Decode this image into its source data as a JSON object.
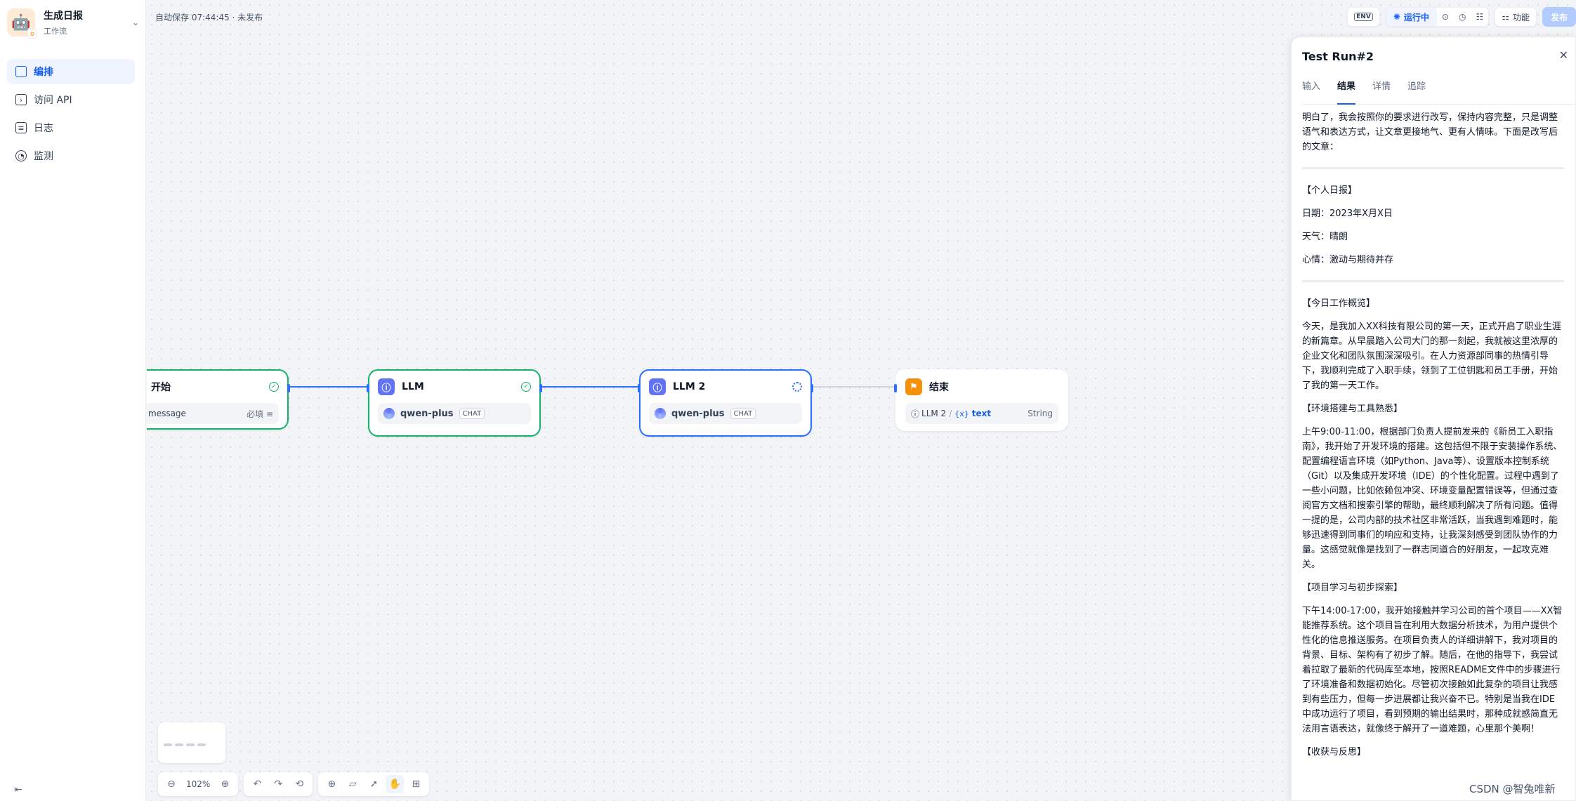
{
  "sidebar": {
    "app_name": "生成日报",
    "app_type": "工作流",
    "nav": [
      {
        "label": "编排",
        "icon": "layout-icon"
      },
      {
        "label": "访问 API",
        "icon": "terminal-icon"
      },
      {
        "label": "日志",
        "icon": "file-icon"
      },
      {
        "label": "监测",
        "icon": "monitor-icon"
      }
    ]
  },
  "header": {
    "autosave": "自动保存 07:44:45 · 未发布",
    "env_label": "ENV",
    "running_label": "运行中",
    "features_label": "功能",
    "publish_label": "发布"
  },
  "nodes": {
    "start": {
      "title": "开始",
      "var_name": "message",
      "var_required": "必填"
    },
    "llm1": {
      "title": "LLM",
      "model": "qwen-plus",
      "mode": "CHAT"
    },
    "llm2": {
      "title": "LLM 2",
      "model": "qwen-plus",
      "mode": "CHAT"
    },
    "end": {
      "title": "结束",
      "var_source": "LLM 2",
      "var_prefix": "{x}",
      "var_name": "text",
      "var_type": "String"
    }
  },
  "canvas": {
    "zoom": "102%"
  },
  "panel": {
    "title": "Test Run#2",
    "tabs": [
      "输入",
      "结果",
      "详情",
      "追踪"
    ],
    "intro": "明白了，我会按照你的要求进行改写，保持内容完整，只是调整语气和表达方式，让文章更接地气、更有人情味。下面是改写后的文章：",
    "report_title": "【个人日报】",
    "date": "日期：2023年X月X日",
    "weather": "天气：晴朗",
    "mood": "心情：激动与期待并存",
    "section1_title": "【今日工作概览】",
    "section1_text": "今天，是我加入XX科技有限公司的第一天，正式开启了职业生涯的新篇章。从早晨踏入公司大门的那一刻起，我就被这里浓厚的企业文化和团队氛围深深吸引。在人力资源部同事的热情引导下，我顺利完成了入职手续，领到了工位钥匙和员工手册，开始了我的第一天工作。",
    "section2_title": "【环境搭建与工具熟悉】",
    "section2_text": "上午9:00-11:00，根据部门负责人提前发来的《新员工入职指南》，我开始了开发环境的搭建。这包括但不限于安装操作系统、配置编程语言环境（如Python、Java等）、设置版本控制系统（Git）以及集成开发环境（IDE）的个性化配置。过程中遇到了一些小问题，比如依赖包冲突、环境变量配置错误等，但通过查阅官方文档和搜索引擎的帮助，最终顺利解决了所有问题。值得一提的是，公司内部的技术社区非常活跃，当我遇到难题时，能够迅速得到同事们的响应和支持，让我深刻感受到团队协作的力量。这感觉就像是找到了一群志同道合的好朋友，一起攻克难关。",
    "section3_title": "【项目学习与初步探索】",
    "section3_text": "下午14:00-17:00，我开始接触并学习公司的首个项目——XX智能推荐系统。这个项目旨在利用大数据分析技术，为用户提供个性化的信息推送服务。在项目负责人的详细讲解下，我对项目的背景、目标、架构有了初步了解。随后，在他的指导下，我尝试着拉取了最新的代码库至本地，按照README文件中的步骤进行了环境准备和数据初始化。尽管初次接触如此复杂的项目让我感到有些压力，但每一步进展都让我兴奋不已。特别是当我在IDE中成功运行了项目，看到预期的输出结果时，那种成就感简直无法用言语表达，就像终于解开了一道难题，心里那个美啊！",
    "section4_title": "【收获与反思】"
  },
  "watermark": "CSDN @智兔唯新",
  "colors": {
    "accent": "#155eef",
    "success": "#17b26a",
    "edge": "#2970ff"
  }
}
